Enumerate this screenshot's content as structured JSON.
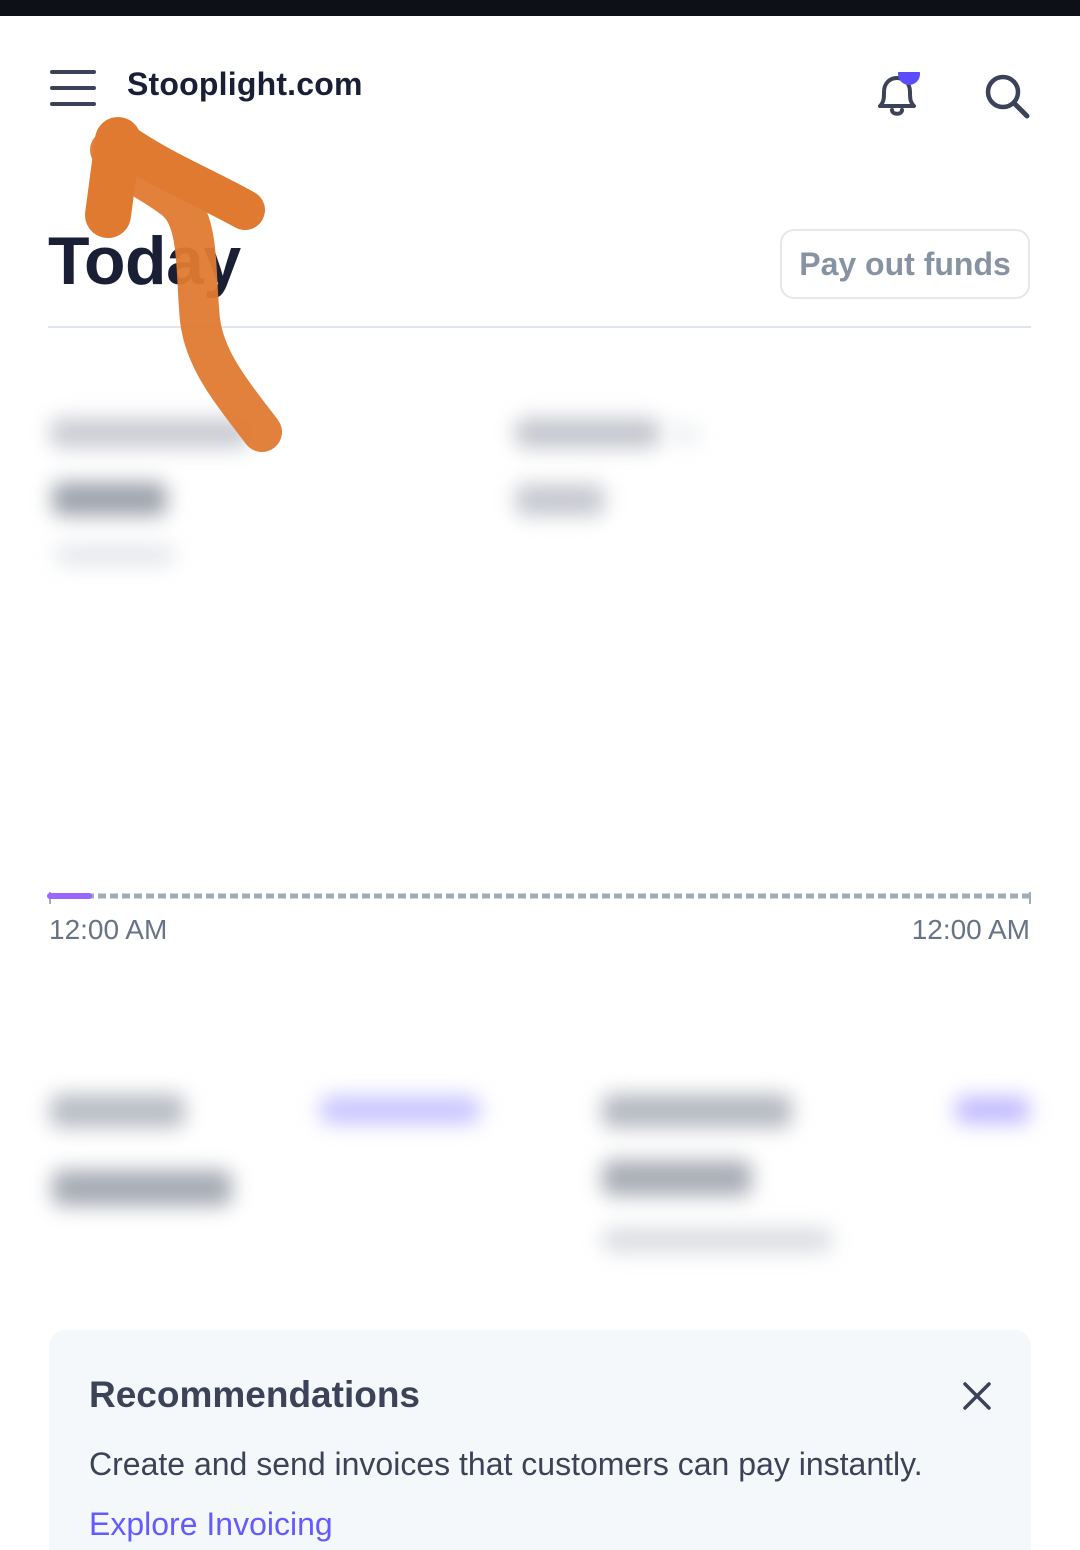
{
  "header": {
    "site_title": "Stooplight.com",
    "notification_dot_color": "#5b4dff"
  },
  "main": {
    "title": "Today",
    "payout_button_label": "Pay out funds"
  },
  "chart": {
    "start_label": "12:00 AM",
    "end_label": "12:00 AM",
    "progress": 0.04,
    "progress_color": "#9966ff"
  },
  "recommendations": {
    "title": "Recommendations",
    "text": "Create and send invoices that customers can pay instantly.",
    "link_label": "Explore Invoicing"
  },
  "colors": {
    "brand": "#635bff",
    "annotation": "#e07a30"
  }
}
